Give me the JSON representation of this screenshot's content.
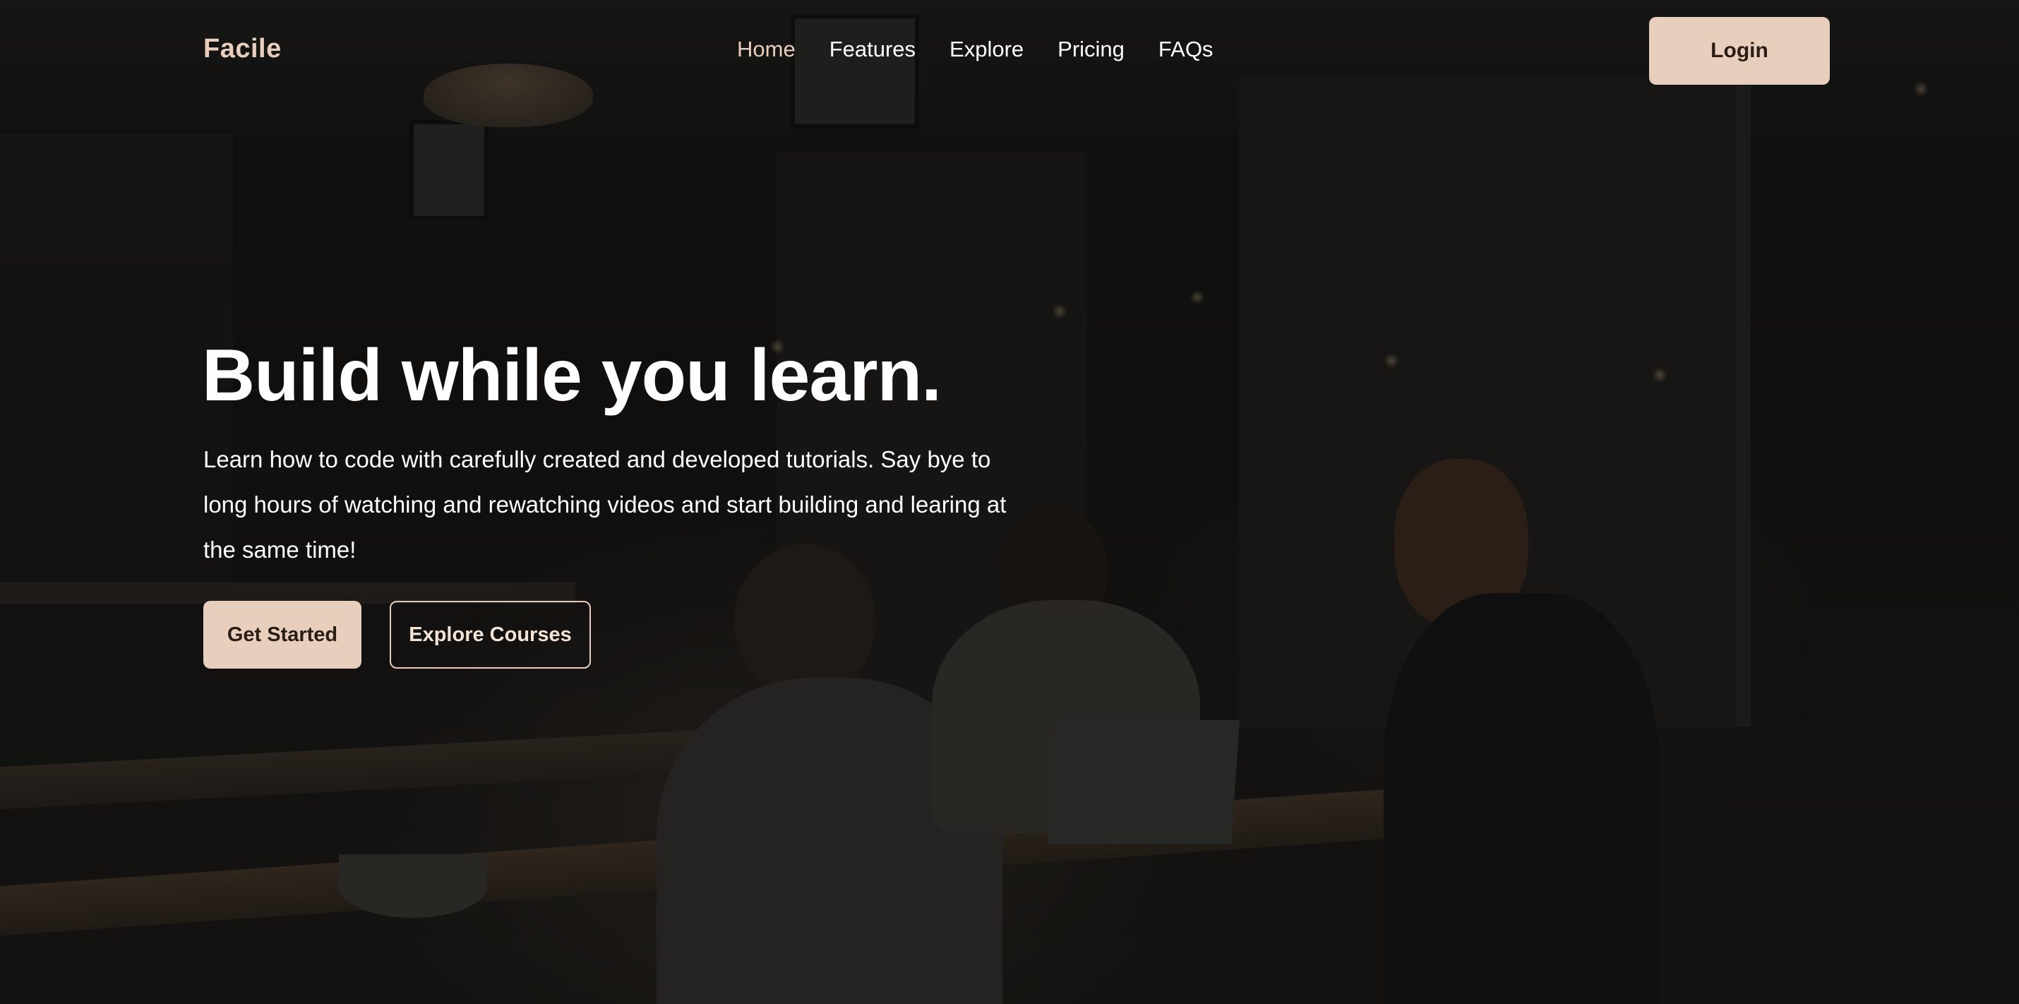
{
  "brand": {
    "name": "Facile",
    "accent_color": "#e8cfbd",
    "text_color": "#ffffff"
  },
  "nav": {
    "links": [
      {
        "label": "Home",
        "active": true
      },
      {
        "label": "Features",
        "active": false
      },
      {
        "label": "Explore",
        "active": false
      },
      {
        "label": "Pricing",
        "active": false
      },
      {
        "label": "FAQs",
        "active": false
      }
    ],
    "login_label": "Login"
  },
  "hero": {
    "title": "Build while you learn.",
    "subtitle": "Learn how to code with carefully created and developed tutorials. Say bye to long hours of watching and rewatching videos and start building and learing at the same time!",
    "primary_cta": "Get Started",
    "secondary_cta": "Explore Courses",
    "background_image": "dark cafe photo of three people talking around a table with a laptop"
  }
}
